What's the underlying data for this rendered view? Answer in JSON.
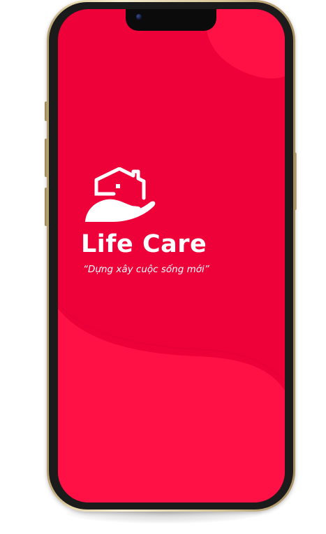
{
  "app": {
    "title": "Life Care",
    "tagline": "“Dựng xây cuộc sống mới”",
    "logo_icon": "house-in-hand-icon"
  },
  "colors": {
    "screen_background": "#ee0038",
    "wave_light": "#ff1146",
    "text": "#ffffff",
    "frame": "#e6d6ab"
  }
}
